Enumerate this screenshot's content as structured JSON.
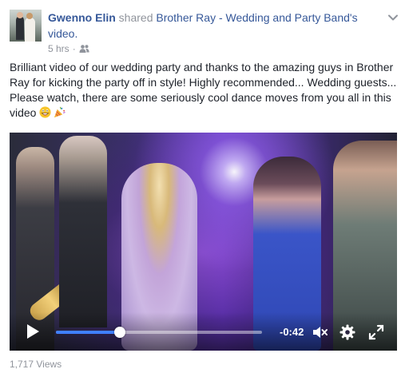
{
  "post": {
    "author": "Gwenno Elin",
    "action_word": "shared",
    "page_name": "Brother Ray - Wedding and Party Band",
    "possessive": "'s",
    "object": "video.",
    "timestamp": "5 hrs",
    "separator": "·",
    "audience_icon": "friends-icon",
    "message": "Brilliant video of our wedding party and thanks to the amazing guys in Brother Ray for kicking the party off in style! Highly recommended... Wedding guests... Please watch, there are some seriously cool dance moves from you all in this video",
    "emojis": [
      "grinning-face-emoji",
      "party-popper-emoji"
    ],
    "emoji_separator": " ",
    "views": "1,717 Views"
  },
  "video": {
    "time_remaining": "-0:42",
    "progress": 0.31,
    "progress_color": "#4080ff",
    "icons": [
      "play-icon",
      "mute-icon",
      "settings-icon",
      "fullscreen-icon"
    ]
  },
  "colors": {
    "link": "#365899",
    "muted": "#90949c",
    "text": "#1d2129"
  }
}
